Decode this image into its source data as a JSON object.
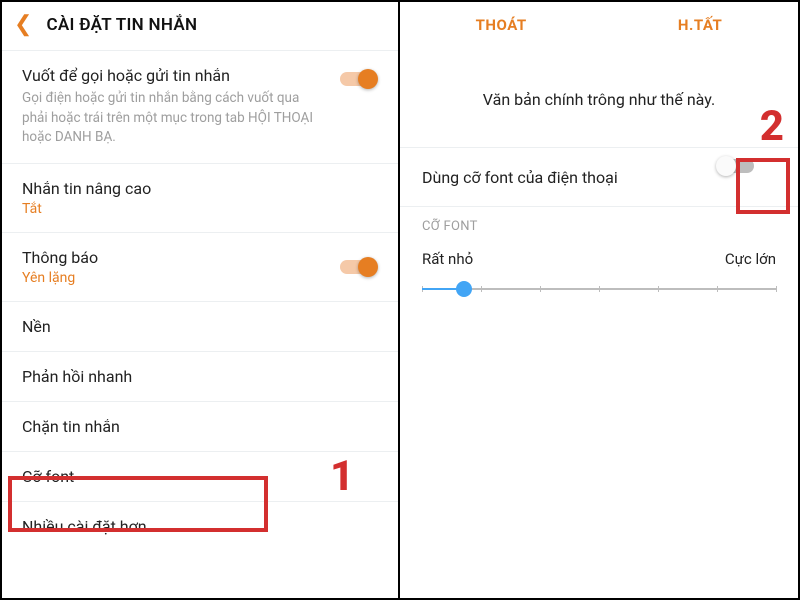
{
  "left": {
    "header_title": "CÀI ĐẶT TIN NHẮN",
    "items": [
      {
        "title": "Vuốt để gọi hoặc gửi tin nhắn",
        "desc": "Gọi điện hoặc gửi tin nhắn bằng cách vuốt qua phải hoặc trái trên một mục trong tab HỘI THOẠI hoặc DANH BẠ.",
        "toggle": true
      },
      {
        "title": "Nhắn tin nâng cao",
        "sub": "Tắt"
      },
      {
        "title": "Thông báo",
        "sub": "Yên lặng",
        "toggle": true
      },
      {
        "title": "Nền"
      },
      {
        "title": "Phản hồi nhanh"
      },
      {
        "title": "Chặn tin nhắn"
      },
      {
        "title": "Cỡ font"
      },
      {
        "title": "Nhiều cài đặt hơn"
      }
    ]
  },
  "right": {
    "header": {
      "cancel": "THOÁT",
      "done": "H.TẤT"
    },
    "preview_text": "Văn bản chính trông như thế này.",
    "use_phone_font_label": "Dùng cỡ font của điện thoại",
    "use_phone_font_on": false,
    "section_label": "CỠ FONT",
    "slider": {
      "min_label": "Rất nhỏ",
      "max_label": "Cực lớn",
      "value_percent": 12
    }
  },
  "annotations": {
    "one": "1",
    "two": "2"
  }
}
